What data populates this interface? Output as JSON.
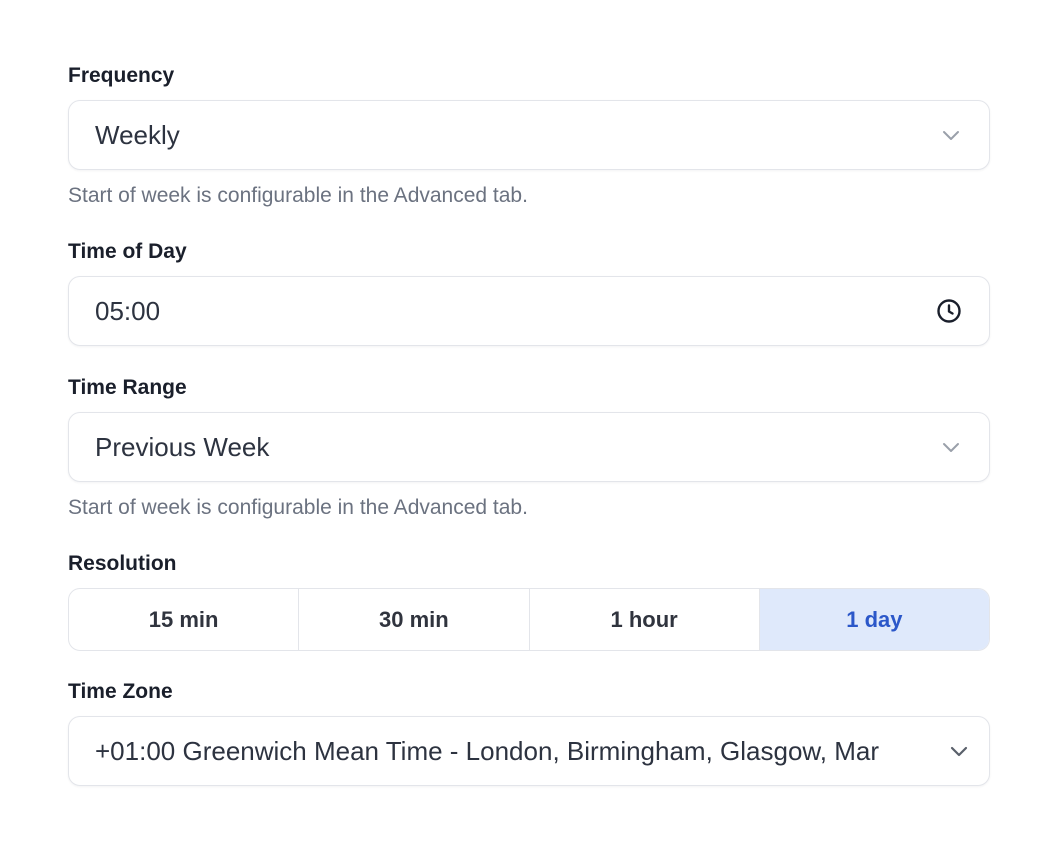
{
  "frequency": {
    "label": "Frequency",
    "value": "Weekly",
    "hint": "Start of week is configurable in the Advanced tab."
  },
  "time_of_day": {
    "label": "Time of Day",
    "value": "05:00"
  },
  "time_range": {
    "label": "Time Range",
    "value": "Previous Week",
    "hint": "Start of week is configurable in the Advanced tab."
  },
  "resolution": {
    "label": "Resolution",
    "options": [
      "15 min",
      "30 min",
      "1 hour",
      "1 day"
    ],
    "selected": "1 day"
  },
  "time_zone": {
    "label": "Time Zone",
    "value": "+01:00 Greenwich Mean Time - London, Birmingham, Glasgow, Mar"
  },
  "colors": {
    "accent": "#2b57c9",
    "accent_bg": "#dfe9fb",
    "border": "#e3e5ea",
    "hint": "#6b7280"
  },
  "icons": {
    "frequency_dropdown": "chevron-down-icon",
    "time_picker": "clock-icon",
    "time_range_dropdown": "chevron-down-icon",
    "time_zone_dropdown": "chevron-down-icon"
  }
}
